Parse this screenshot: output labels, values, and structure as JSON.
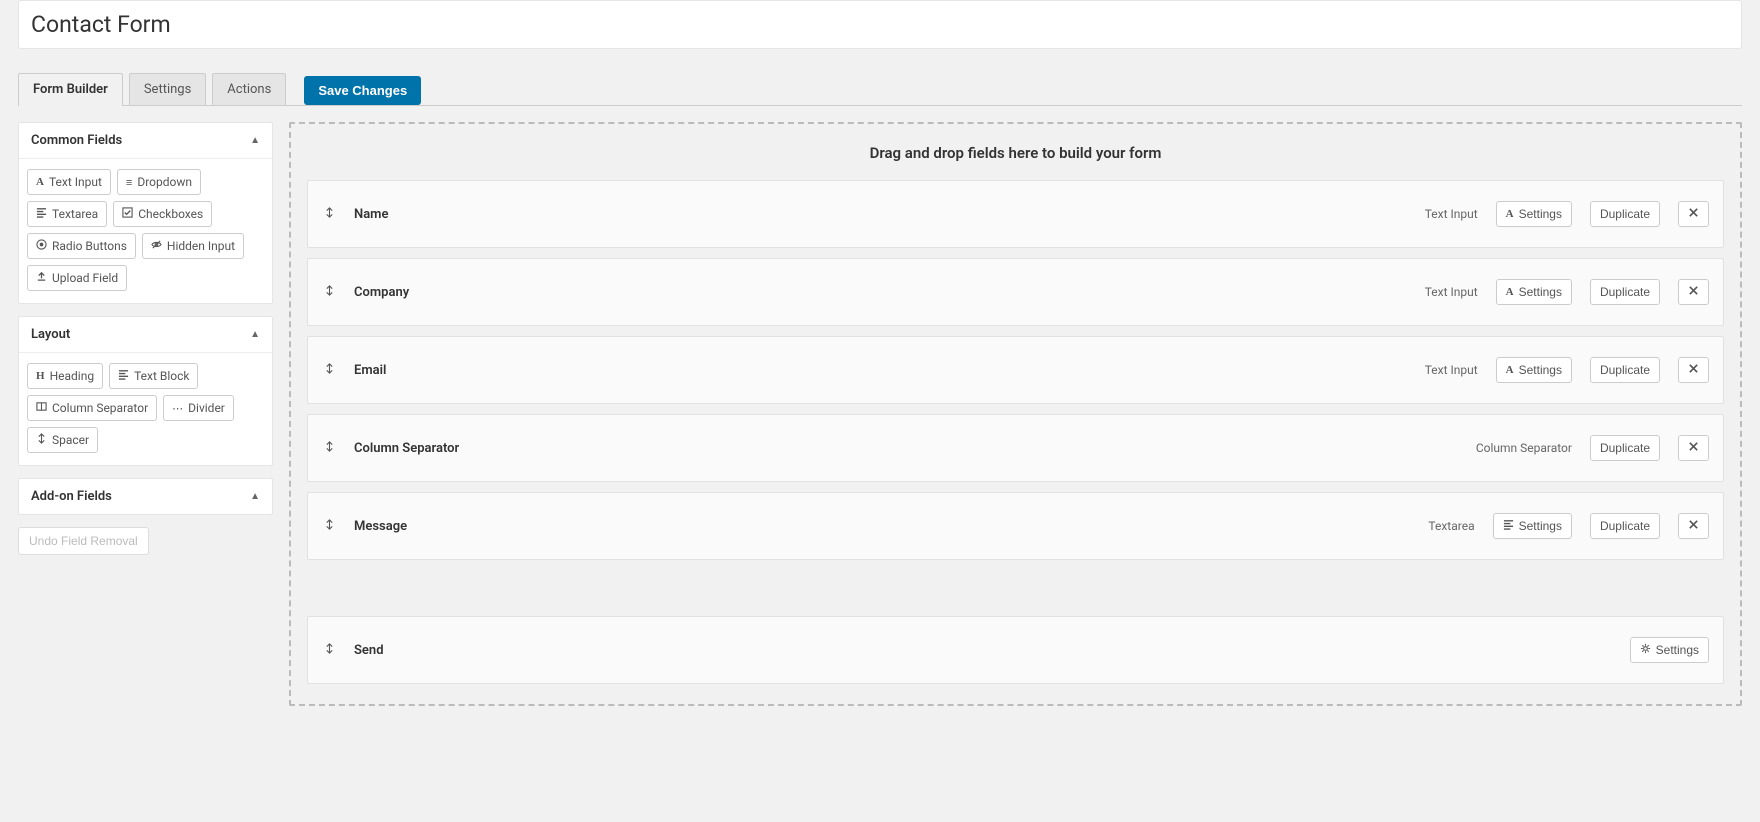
{
  "page": {
    "title": "Contact Form"
  },
  "tabs": {
    "form_builder": "Form Builder",
    "settings": "Settings",
    "actions": "Actions"
  },
  "save_button": "Save Changes",
  "sidebar": {
    "common_fields": {
      "title": "Common Fields",
      "items": {
        "text_input": "Text Input",
        "dropdown": "Dropdown",
        "textarea": "Textarea",
        "checkboxes": "Checkboxes",
        "radio_buttons": "Radio Buttons",
        "hidden_input": "Hidden Input",
        "upload_field": "Upload Field"
      }
    },
    "layout": {
      "title": "Layout",
      "items": {
        "heading": "Heading",
        "text_block": "Text Block",
        "column_separator": "Column Separator",
        "divider": "Divider",
        "spacer": "Spacer"
      }
    },
    "addon_fields": {
      "title": "Add-on Fields"
    },
    "undo_button": "Undo Field Removal"
  },
  "dropzone": {
    "title": "Drag and drop fields here to build your form",
    "settings_label": "Settings",
    "duplicate_label": "Duplicate",
    "rows": [
      {
        "label": "Name",
        "type": "Text Input",
        "has_type_icon": true,
        "type_icon": "A",
        "has_settings": true,
        "has_duplicate": true,
        "has_delete": true
      },
      {
        "label": "Company",
        "type": "Text Input",
        "has_type_icon": true,
        "type_icon": "A",
        "has_settings": true,
        "has_duplicate": true,
        "has_delete": true
      },
      {
        "label": "Email",
        "type": "Text Input",
        "has_type_icon": true,
        "type_icon": "A",
        "has_settings": true,
        "has_duplicate": true,
        "has_delete": true
      },
      {
        "label": "Column Separator",
        "type": "Column Separator",
        "has_type_icon": false,
        "has_settings": false,
        "has_duplicate": true,
        "has_delete": true
      },
      {
        "label": "Message",
        "type": "Textarea",
        "has_type_icon": true,
        "type_icon": "bars",
        "has_settings": true,
        "has_duplicate": true,
        "has_delete": true
      }
    ],
    "submit_row": {
      "label": "Send",
      "settings_icon": "gear"
    }
  }
}
